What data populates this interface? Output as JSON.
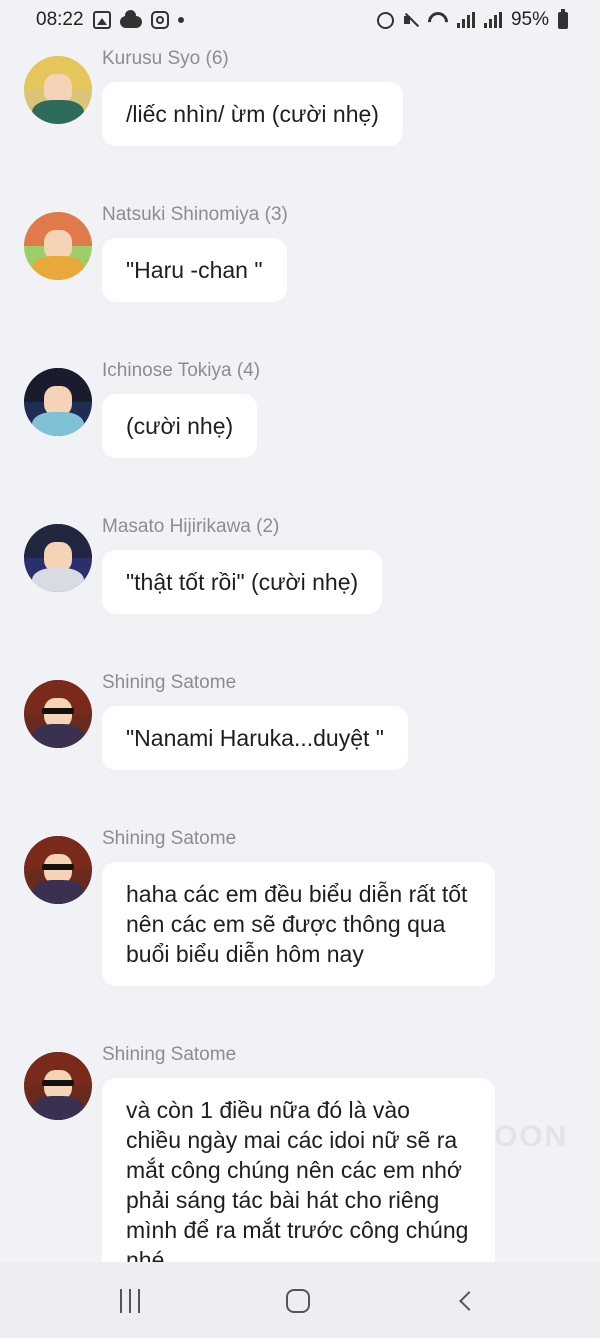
{
  "status_bar": {
    "time": "08:22",
    "left_icons": [
      "image-icon",
      "cloud-icon",
      "instagram-icon",
      "dot-icon"
    ],
    "right_icons": [
      "alarm-icon",
      "mute-icon",
      "wifi-icon",
      "signal-icon",
      "signal-icon",
      "battery-icon"
    ],
    "battery": "95%"
  },
  "messages": [
    {
      "sender": "Kurusu Syo (6)",
      "text": "/liếc nhìn/ ừm (cười nhẹ)"
    },
    {
      "sender": "Natsuki Shinomiya (3)",
      "text": "\"Haru -chan \""
    },
    {
      "sender": "Ichinose Tokiya (4)",
      "text": "(cười nhẹ)"
    },
    {
      "sender": "Masato Hijirikawa (2)",
      "text": "\"thật tốt rồi\" (cười nhẹ)"
    },
    {
      "sender": "Shining Satome",
      "text": "\"Nanami Haruka...duyệt \""
    },
    {
      "sender": "Shining Satome",
      "text": "haha các em đều biểu diễn rất tốt nên các em sẽ được thông qua buổi biểu diễn hôm nay"
    },
    {
      "sender": "Shining Satome",
      "text": "và còn 1 điều nữa đó là vào chiều ngày mai các idoi nữ sẽ ra mắt công chúng nên các em nhớ phải sáng tác bài hát cho riêng mình để ra mắt trước công chúng nhé"
    }
  ],
  "watermark": "OON",
  "nav_bar": {
    "icons": [
      "recents-icon",
      "home-icon",
      "back-icon"
    ]
  }
}
